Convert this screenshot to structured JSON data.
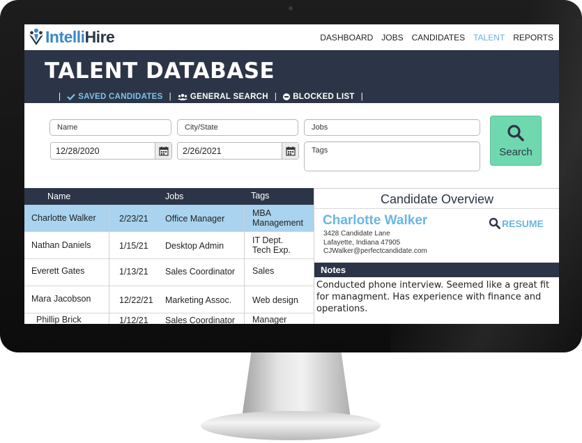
{
  "brand": {
    "logo_prefix": "Intelli",
    "logo_suffix": "Hire"
  },
  "nav": {
    "items": [
      {
        "label": "DASHBOARD",
        "active": false
      },
      {
        "label": "JOBS",
        "active": false
      },
      {
        "label": "CANDIDATES",
        "active": false
      },
      {
        "label": "TALENT",
        "active": true
      },
      {
        "label": "REPORTS",
        "active": false
      }
    ]
  },
  "banner": {
    "title": "TALENT DATABASE",
    "sep": "|",
    "tabs": [
      {
        "label": "SAVED CANDIDATES",
        "icon": "check-icon",
        "active": true
      },
      {
        "label": "GENERAL SEARCH",
        "icon": "users-icon",
        "active": false
      },
      {
        "label": "BLOCKED LIST",
        "icon": "block-icon",
        "active": false
      }
    ]
  },
  "search": {
    "name_placeholder": "Name",
    "city_placeholder": "City/State",
    "jobs_placeholder": "Jobs",
    "tags_placeholder": "Tags",
    "date_from": "12/28/2020",
    "date_to": "2/26/2021",
    "button_label": "Search"
  },
  "table": {
    "headers": {
      "name": "Name",
      "jobs": "Jobs",
      "tags": "Tags"
    },
    "rows": [
      {
        "name": "Charlotte Walker",
        "date": "2/23/21",
        "job": "Office Manager",
        "tags": [
          "MBA",
          "Management"
        ],
        "selected": true
      },
      {
        "name": "Nathan Daniels",
        "date": "1/15/21",
        "job": "Desktop Admin",
        "tags": [
          "IT Dept.",
          "Tech Exp."
        ],
        "selected": false
      },
      {
        "name": "Everett Gates",
        "date": "1/13/21",
        "job": "Sales Coordinator",
        "tags": [
          "Sales"
        ],
        "selected": false
      },
      {
        "name": "Mara Jacobson",
        "date": "12/22/21",
        "job": "Marketing Assoc.",
        "tags": [
          "Web design"
        ],
        "selected": false
      },
      {
        "name": "Phillip Brick",
        "date": "1/12/21",
        "job": "Sales Coordinator",
        "tags": [
          "Manager"
        ],
        "selected": false
      }
    ]
  },
  "overview": {
    "title": "Candidate Overview",
    "name": "Charlotte Walker",
    "address_line1": "3428 Candidate Lane",
    "address_line2": "Lafayette, Indiana 47905",
    "email": "CJWalker@perfectcandidate.com",
    "resume_label": "RESUME",
    "notes_label": "Notes",
    "notes": "Conducted phone interview. Seemed like a great fit for managment. Has experience with finance and operations."
  },
  "colors": {
    "banner": "#2c3547",
    "accent": "#6ab6e2",
    "search_button": "#6fd8ae",
    "selected_row": "#a9d3ee"
  }
}
